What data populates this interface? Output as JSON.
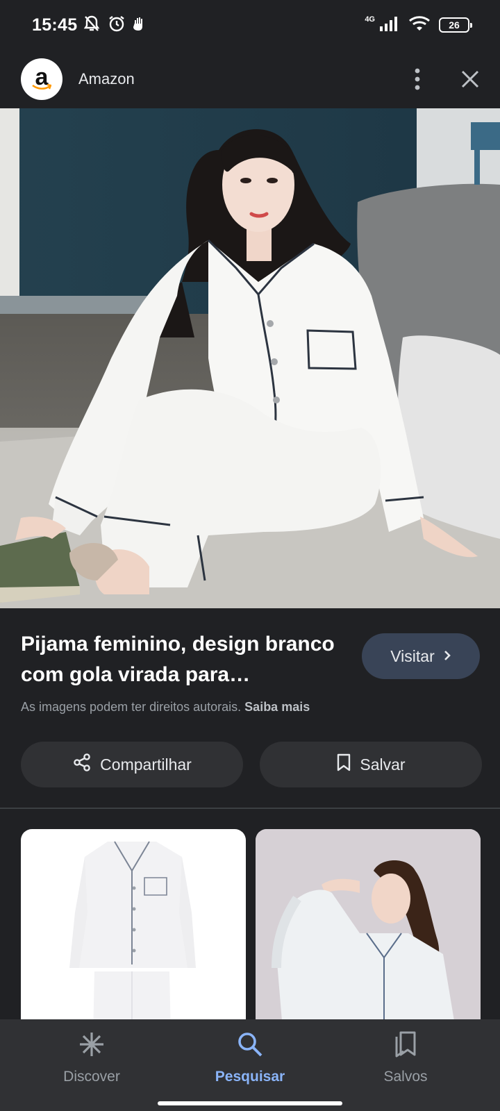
{
  "status_bar": {
    "time": "15:45",
    "network_label": "4G",
    "battery_level": "26",
    "icons": [
      "mute-bell-icon",
      "alarm-icon",
      "hand-icon",
      "signal-icon",
      "wifi-icon",
      "battery-icon"
    ]
  },
  "header": {
    "source_logo_letter": "a",
    "source_name": "Amazon",
    "icons": [
      "more-vert-icon",
      "close-icon"
    ]
  },
  "product": {
    "title": "Pijama feminino, design branco com gola virada para…",
    "visit_label": "Visitar",
    "copyright_text": "As imagens podem ter direitos autorais.",
    "learn_more_label": "Saiba mais"
  },
  "actions": {
    "share_label": "Compartilhar",
    "save_label": "Salvar"
  },
  "bottom_nav": {
    "items": [
      {
        "label": "Discover",
        "icon": "asterisk-icon",
        "active": false
      },
      {
        "label": "Pesquisar",
        "icon": "search-icon",
        "active": true
      },
      {
        "label": "Salvos",
        "icon": "bookmarks-icon",
        "active": false
      }
    ]
  },
  "colors": {
    "background": "#202124",
    "accent": "#8ab4f8",
    "visit_button": "#394457",
    "pill_button": "#303134"
  }
}
